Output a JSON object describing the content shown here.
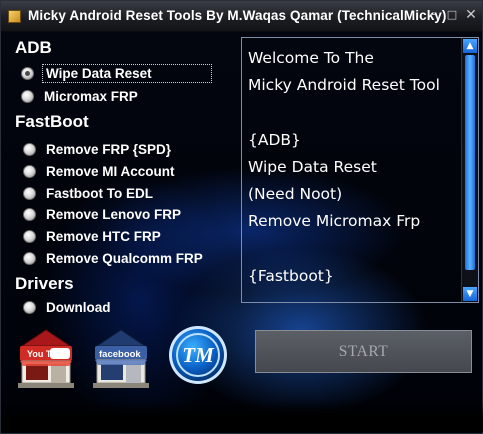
{
  "window": {
    "title": "Micky Android Reset Tools By M.Waqas Qamar (TechnicalMicky)",
    "controls": {
      "minimize": "–",
      "maximize": "□",
      "close": "✕"
    }
  },
  "adb": {
    "heading": "ADB",
    "options": [
      {
        "label": "Wipe Data Reset",
        "checked": true
      },
      {
        "label": "Micromax FRP",
        "checked": false
      }
    ]
  },
  "fastboot": {
    "heading": "FastBoot",
    "options": [
      {
        "label": "Remove FRP {SPD}"
      },
      {
        "label": "Remove MI Account"
      },
      {
        "label": "Fastboot To EDL"
      },
      {
        "label": "Remove Lenovo FRP"
      },
      {
        "label": "Remove HTC FRP"
      },
      {
        "label": "Remove Qualcomm FRP"
      }
    ]
  },
  "drivers": {
    "heading": "Drivers",
    "options": [
      {
        "label": "Download"
      }
    ]
  },
  "log": {
    "text": "Welcome To The\nMicky Android Reset Tool\n\n{ADB}\nWipe Data Reset\n(Need Noot)\nRemove Micromax Frp\n\n{Fastboot}"
  },
  "start_button": {
    "label": "START",
    "enabled": false
  },
  "links": {
    "youtube": {
      "label": "You Tube",
      "icon": "youtube-store-icon"
    },
    "facebook": {
      "label": "facebook",
      "icon": "facebook-store-icon"
    },
    "tm": {
      "label": "TM",
      "icon": "tm-logo-icon"
    }
  },
  "colors": {
    "accent": "#2f86ff",
    "text": "#ffffff",
    "youtube_red": "#c8201c",
    "facebook_blue": "#2c4d8a"
  }
}
